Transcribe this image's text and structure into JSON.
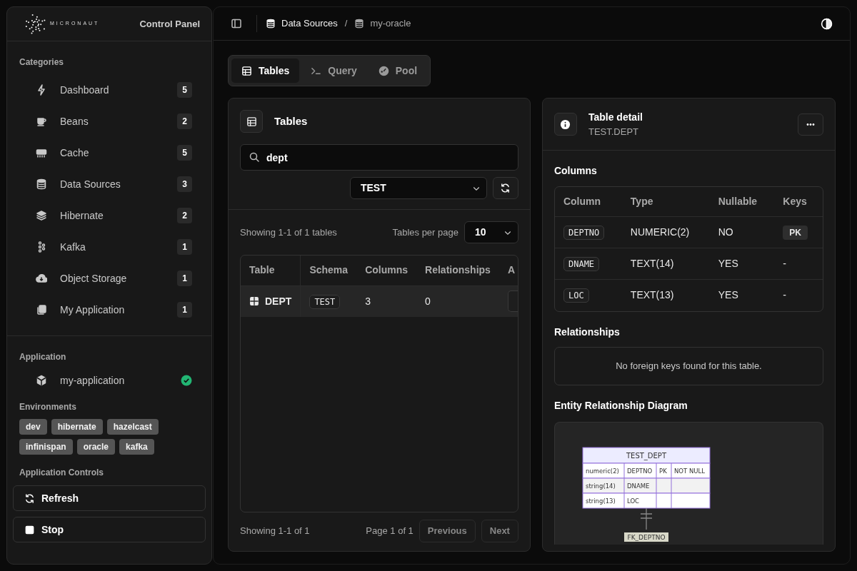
{
  "sidebar": {
    "brand": "MICRONAUT",
    "title": "Control Panel",
    "categories_heading": "Categories",
    "categories": [
      {
        "label": "Dashboard",
        "count": "5",
        "selected": false
      },
      {
        "label": "Beans",
        "count": "2",
        "selected": false
      },
      {
        "label": "Cache",
        "count": "5",
        "selected": false
      },
      {
        "label": "Data Sources",
        "count": "3",
        "selected": false
      },
      {
        "label": "Hibernate",
        "count": "2",
        "selected": false
      },
      {
        "label": "Kafka",
        "count": "1",
        "selected": false
      },
      {
        "label": "Object Storage",
        "count": "1",
        "selected": false
      },
      {
        "label": "My Application",
        "count": "1",
        "selected": false
      }
    ],
    "application_heading": "Application",
    "application": {
      "name": "my-application",
      "healthy": true
    },
    "environments_heading": "Environments",
    "environments": [
      "dev",
      "hibernate",
      "hazelcast",
      "infinispan",
      "oracle",
      "kafka"
    ],
    "controls_heading": "Application Controls",
    "controls": [
      {
        "label": "Refresh",
        "kind": "refresh"
      },
      {
        "label": "Stop",
        "kind": "stop"
      }
    ]
  },
  "breadcrumb_separator": "/",
  "breadcrumb": [
    {
      "label": "Data Sources",
      "current": false
    },
    {
      "label": "my-oracle",
      "current": true
    }
  ],
  "tabs": [
    {
      "label": "Tables",
      "selected": true
    },
    {
      "label": "Query",
      "selected": false
    },
    {
      "label": "Pool",
      "selected": false
    }
  ],
  "tables_panel": {
    "title": "Tables",
    "search": {
      "value": "dept"
    },
    "schema_select": {
      "value": "TEST"
    },
    "summary": "Showing 1-1 of 1 tables",
    "per_page_label": "Tables per page",
    "per_page": "10",
    "table": {
      "columns": [
        "Table",
        "Schema",
        "Columns",
        "Relationships",
        "A"
      ],
      "rows": [
        {
          "name": "DEPT",
          "schema": "TEST",
          "columns": "3",
          "relationships": "0",
          "selected": true
        }
      ]
    },
    "footer_summary": "Showing 1-1 of 1",
    "page_info": "Page 1 of 1",
    "buttons": [
      "Previous",
      "Next"
    ]
  },
  "detail_panel": {
    "title": "Table detail",
    "subtitle": "TEST.DEPT",
    "columns_heading": "Columns",
    "columns_table": {
      "columns": [
        "Column",
        "Type",
        "Nullable",
        "Keys"
      ],
      "rows": [
        {
          "column": "DEPTNO",
          "type": "NUMERIC(2)",
          "nullable": "NO",
          "keys": "PK",
          "primary": true
        },
        {
          "column": "DNAME",
          "type": "TEXT(14)",
          "nullable": "YES",
          "keys": "-",
          "primary": false
        },
        {
          "column": "LOC",
          "type": "TEXT(13)",
          "nullable": "YES",
          "keys": "-",
          "primary": false
        }
      ]
    },
    "relationships_heading": "Relationships",
    "relationships_empty": "No foreign keys found for this table.",
    "erd_heading": "Entity Relationship Diagram",
    "erd": {
      "entity": "TEST_DEPT",
      "attributes": [
        {
          "type": "numeric(2)",
          "name": "DEPTNO",
          "key": "PK",
          "comment": "NOT NULL"
        },
        {
          "type": "string(14)",
          "name": "DNAME"
        },
        {
          "type": "string(13)",
          "name": "LOC"
        }
      ],
      "relationship_label": "FK_DEPTNO"
    }
  }
}
